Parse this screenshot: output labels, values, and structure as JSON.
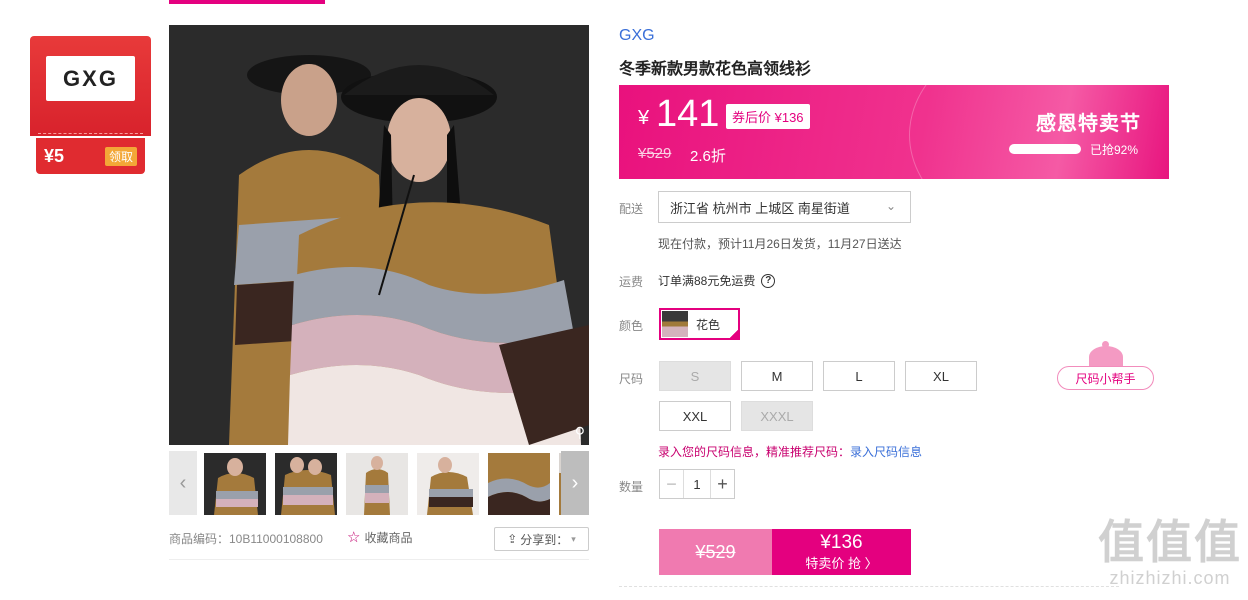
{
  "coupon": {
    "logo_text": "GXG",
    "amount": "¥5",
    "action": "领取"
  },
  "product": {
    "brand": "GXG",
    "title": "冬季新款男款花色高领线衫",
    "sku_label": "商品编码：10B11000108800",
    "favorite_label": "收藏商品",
    "share_label": "分享到："
  },
  "price": {
    "currency": "¥",
    "current": "141",
    "coupon_price": "券后价 ¥136",
    "original": "¥529",
    "discount": "2.6折",
    "promo_name": "感恩特卖节",
    "sold_text": "已抢92%",
    "sold_fraction": 0.92
  },
  "shipping": {
    "label": "配送",
    "location": "浙江省 杭州市 上城区 南星街道",
    "note": "现在付款，预计11月26日发货，11月27日送达",
    "fee_label": "运费",
    "fee_text": "订单满88元免运费"
  },
  "color": {
    "label": "颜色",
    "selected": "花色"
  },
  "size": {
    "label": "尺码",
    "options": [
      "S",
      "M",
      "L",
      "XL",
      "XXL",
      "XXXL"
    ],
    "disabled": [
      "S",
      "XXXL"
    ],
    "helper_label": "尺码小帮手",
    "tip_text": "录入您的尺码信息，精准推荐尺码：",
    "tip_link": "录入尺码信息"
  },
  "quantity": {
    "label": "数量",
    "value": "1"
  },
  "buy": {
    "original": "¥529",
    "price": "¥136",
    "action": "特卖价 抢 〉"
  },
  "watermark": {
    "logo": "值值值",
    "url": "zhizhizhi.com"
  },
  "colors": {
    "accent": "#e4007f",
    "link": "#3a6fd8",
    "coupon_red": "#d8222c"
  }
}
